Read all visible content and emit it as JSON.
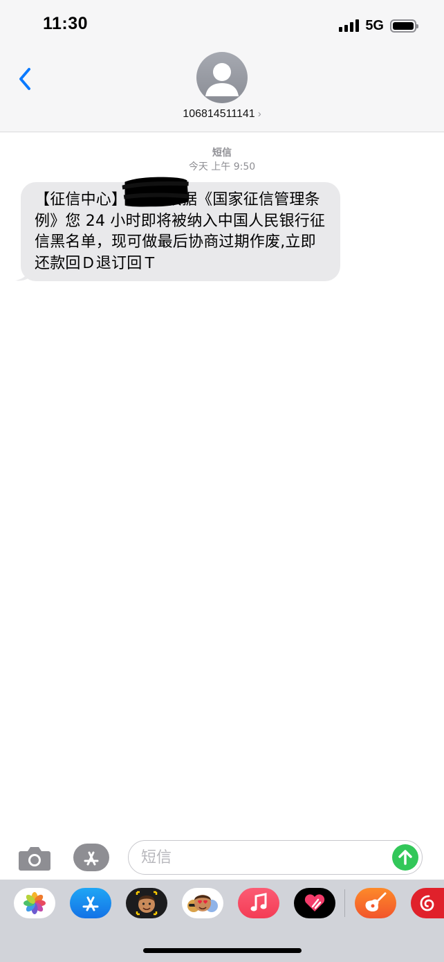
{
  "status_bar": {
    "time": "11:30",
    "network": "5G"
  },
  "header": {
    "back_icon": "chevron-left-icon",
    "contact_number": "106814511141",
    "contact_chevron": "›"
  },
  "conversation": {
    "service_label": "短信",
    "timestamp": "今天 上午 9:50",
    "messages": [
      {
        "direction": "incoming",
        "text": "【征信中心】        根据《国家征信管理条例》您 24 小时即将被纳入中国人民银行征信黑名单，现可做最后协商过期作废,立即还款回Ｄ退订回Ｔ",
        "redacted": true
      }
    ]
  },
  "input_bar": {
    "placeholder": "短信",
    "value": "",
    "icons": [
      "camera-icon",
      "app-store-icon",
      "send-arrow-icon"
    ]
  },
  "app_drawer": {
    "apps": [
      "photos",
      "app-store",
      "memoji",
      "animoji-stickers",
      "music",
      "digital-touch",
      "garageband",
      "netease-music"
    ]
  },
  "colors": {
    "header_bg": "#f6f6f7",
    "bubble_incoming": "#e9e9eb",
    "accent_blue": "#0a7aff",
    "send_green": "#32c759",
    "drawer_bg": "#d1d3d9"
  }
}
